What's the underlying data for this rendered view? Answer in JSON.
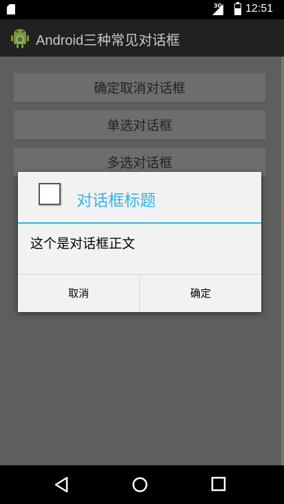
{
  "status_bar": {
    "network": "3G",
    "time": "12:51",
    "icons": [
      "sd-card-icon",
      "signal-icon",
      "battery-icon"
    ]
  },
  "app_bar": {
    "title": "Android三种常见对话框",
    "logo_icon": "android-icon"
  },
  "buttons": [
    "确定取消对话框",
    "单选对话框",
    "多选对话框"
  ],
  "dialog": {
    "icon": "checkbox-icon",
    "title": "对话框标题",
    "message": "这个是对话框正文",
    "negative_button": "取消",
    "positive_button": "确定",
    "accent_color": "#33b5e5"
  },
  "nav_bar": {
    "icons": [
      "back-icon",
      "home-icon",
      "recents-icon"
    ]
  }
}
